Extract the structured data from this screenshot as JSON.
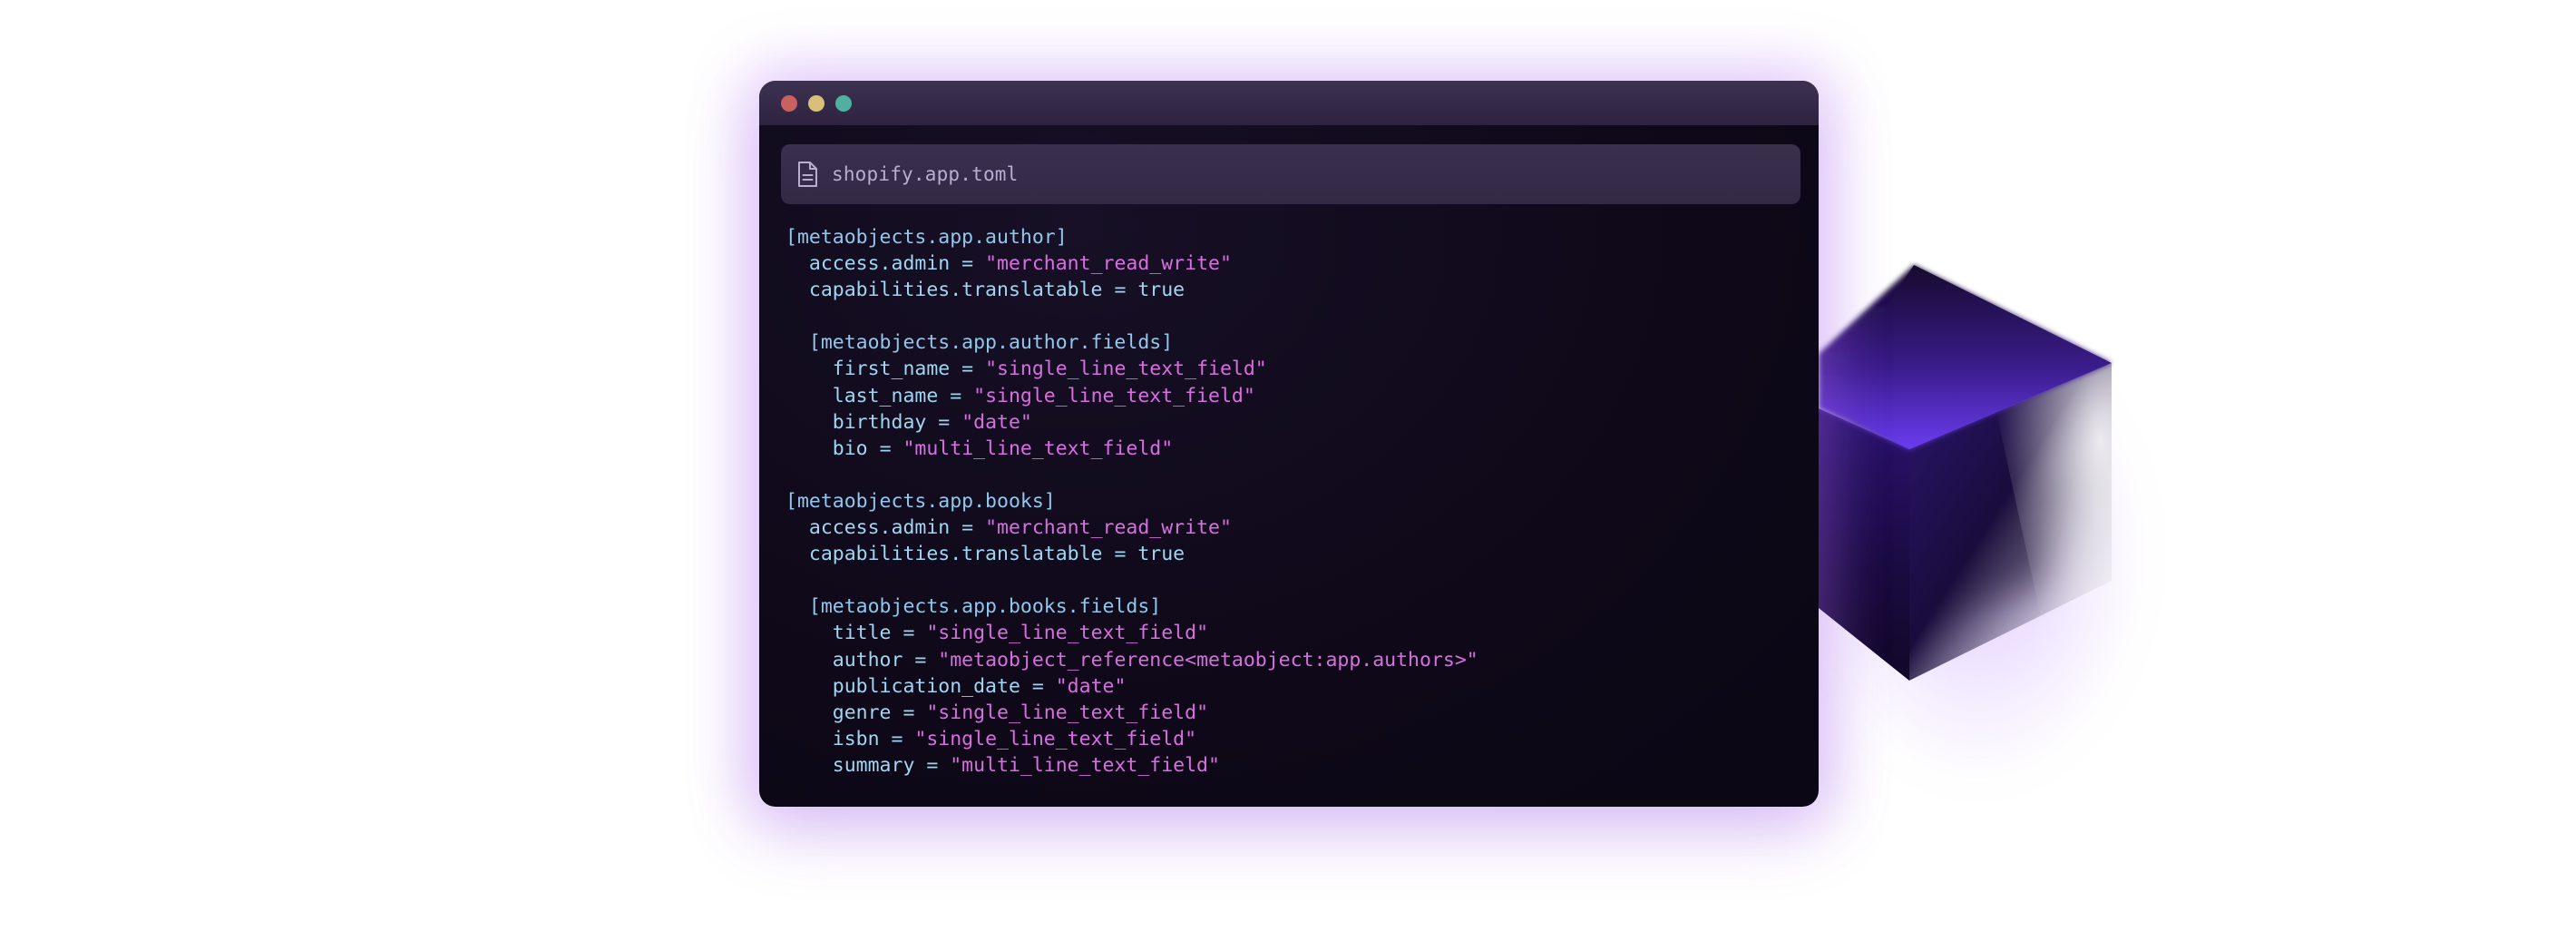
{
  "window": {
    "title_dots": [
      "close",
      "minimize",
      "zoom"
    ],
    "colors": {
      "background": "#0e0818",
      "titlebar": "#33283f",
      "dot_close": "#c9615f",
      "dot_minimize": "#d8c07a",
      "dot_zoom": "#4fb0a2",
      "key_text": "#9fd6f2",
      "string_text": "#d86fe0",
      "glow": "#be78ff"
    }
  },
  "file": {
    "icon": "file-document-icon",
    "name": "shopify.app.toml"
  },
  "code_lines": [
    {
      "indent": "",
      "key": "[metaobjects.app.author]",
      "op": "",
      "value": "",
      "kind": "header"
    },
    {
      "indent": "  ",
      "key": "access.admin",
      "op": " = ",
      "value": "\"merchant_read_write\"",
      "kind": "string"
    },
    {
      "indent": "  ",
      "key": "capabilities.translatable",
      "op": " = ",
      "value": "true",
      "kind": "bool"
    },
    {
      "indent": "",
      "key": "",
      "op": "",
      "value": "",
      "kind": "blank"
    },
    {
      "indent": "  ",
      "key": "[metaobjects.app.author.fields]",
      "op": "",
      "value": "",
      "kind": "header"
    },
    {
      "indent": "    ",
      "key": "first_name",
      "op": " = ",
      "value": "\"single_line_text_field\"",
      "kind": "string"
    },
    {
      "indent": "    ",
      "key": "last_name",
      "op": " = ",
      "value": "\"single_line_text_field\"",
      "kind": "string"
    },
    {
      "indent": "    ",
      "key": "birthday",
      "op": " = ",
      "value": "\"date\"",
      "kind": "string"
    },
    {
      "indent": "    ",
      "key": "bio",
      "op": " = ",
      "value": "\"multi_line_text_field\"",
      "kind": "string"
    },
    {
      "indent": "",
      "key": "",
      "op": "",
      "value": "",
      "kind": "blank"
    },
    {
      "indent": "",
      "key": "[metaobjects.app.books]",
      "op": "",
      "value": "",
      "kind": "header"
    },
    {
      "indent": "  ",
      "key": "access.admin",
      "op": " = ",
      "value": "\"merchant_read_write\"",
      "kind": "string"
    },
    {
      "indent": "  ",
      "key": "capabilities.translatable",
      "op": " = ",
      "value": "true",
      "kind": "bool"
    },
    {
      "indent": "",
      "key": "",
      "op": "",
      "value": "",
      "kind": "blank"
    },
    {
      "indent": "  ",
      "key": "[metaobjects.app.books.fields]",
      "op": "",
      "value": "",
      "kind": "header"
    },
    {
      "indent": "    ",
      "key": "title",
      "op": " = ",
      "value": "\"single_line_text_field\"",
      "kind": "string"
    },
    {
      "indent": "    ",
      "key": "author",
      "op": " = ",
      "value": "\"metaobject_reference<metaobject:app.authors>\"",
      "kind": "string"
    },
    {
      "indent": "    ",
      "key": "publication_date",
      "op": " = ",
      "value": "\"date\"",
      "kind": "string"
    },
    {
      "indent": "    ",
      "key": "genre",
      "op": " = ",
      "value": "\"single_line_text_field\"",
      "kind": "string"
    },
    {
      "indent": "    ",
      "key": "isbn",
      "op": " = ",
      "value": "\"single_line_text_field\"",
      "kind": "string"
    },
    {
      "indent": "    ",
      "key": "summary",
      "op": " = ",
      "value": "\"multi_line_text_field\"",
      "kind": "string"
    }
  ],
  "decoration": {
    "icon": "cube-icon"
  }
}
